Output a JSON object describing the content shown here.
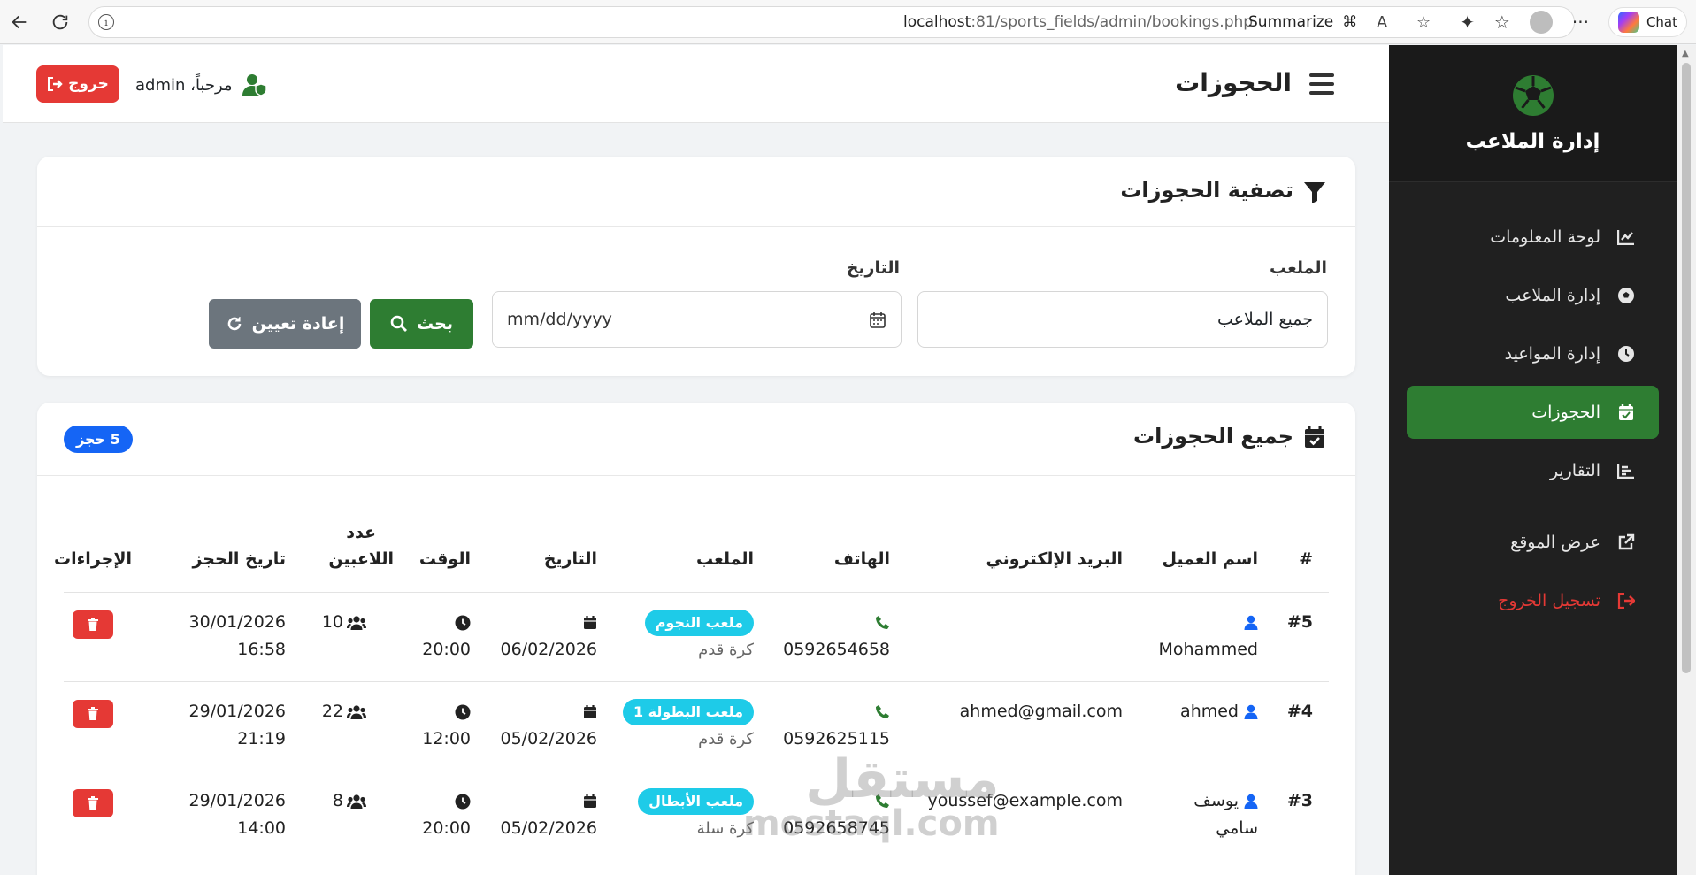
{
  "browser": {
    "url_host": "localhost",
    "url_rest": ":81/sports_fields/admin/bookings.php",
    "summarize": "Summarize",
    "chat": "Chat"
  },
  "sidebar": {
    "brand": "إدارة الملاعب",
    "items": [
      {
        "label": "لوحة المعلومات",
        "icon": "chart-line-icon"
      },
      {
        "label": "إدارة الملاعب",
        "icon": "soccer-ball-icon"
      },
      {
        "label": "إدارة المواعيد",
        "icon": "clock-icon"
      },
      {
        "label": "الحجوزات",
        "icon": "calendar-check-icon",
        "active": true
      },
      {
        "label": "التقارير",
        "icon": "chart-bar-icon"
      }
    ],
    "view_site": "عرض الموقع",
    "logout": "تسجيل الخروج"
  },
  "header": {
    "title": "الحجوزات",
    "welcome": "مرحباً، admin",
    "logout": "خروج"
  },
  "filter": {
    "title": "تصفية الحجوزات",
    "field_label": "الملعب",
    "field_value": "جميع الملاعب",
    "date_label": "التاريخ",
    "date_placeholder": "mm/dd/yyyy",
    "search": "بحث",
    "reset": "إعادة تعيين"
  },
  "bookings": {
    "title": "جميع الحجوزات",
    "count": "5 حجز",
    "columns": {
      "num": "#",
      "name": "اسم العميل",
      "email": "البريد الإلكتروني",
      "phone": "الهاتف",
      "field": "الملعب",
      "date": "التاريخ",
      "time": "الوقت",
      "players_1": "عدد",
      "players_2": "اللاعبين",
      "booked_at": "تاريخ الحجز",
      "actions": "الإجراءات"
    },
    "rows": [
      {
        "num": "#5",
        "name_1": "",
        "name_2": "Mohammed",
        "email": "",
        "phone": "0592654658",
        "field": "ملعب النجوم",
        "sport": "كرة قدم",
        "date": "06/02/2026",
        "time": "20:00",
        "players": "10",
        "booked_date": "30/01/2026",
        "booked_time": "16:58"
      },
      {
        "num": "#4",
        "name_1": "ahmed",
        "name_2": "",
        "email": "ahmed@gmail.com",
        "phone": "0592625115",
        "field": "ملعب البطولة 1",
        "sport": "كرة قدم",
        "date": "05/02/2026",
        "time": "12:00",
        "players": "22",
        "booked_date": "29/01/2026",
        "booked_time": "21:19"
      },
      {
        "num": "#3",
        "name_1": "يوسف",
        "name_2": "سامي",
        "email": "youssef@example.com",
        "phone": "0592658745",
        "field": "ملعب الأبطال",
        "sport": "كرة سلة",
        "date": "05/02/2026",
        "time": "20:00",
        "players": "8",
        "booked_date": "29/01/2026",
        "booked_time": "14:00"
      }
    ]
  },
  "watermark": {
    "ar": "مستقل",
    "en": "mostaql.com"
  },
  "colors": {
    "green": "#2e7d32",
    "red": "#e53935",
    "blue": "#1565f5",
    "cyan": "#1ecbe8",
    "sidebar": "#202020"
  }
}
